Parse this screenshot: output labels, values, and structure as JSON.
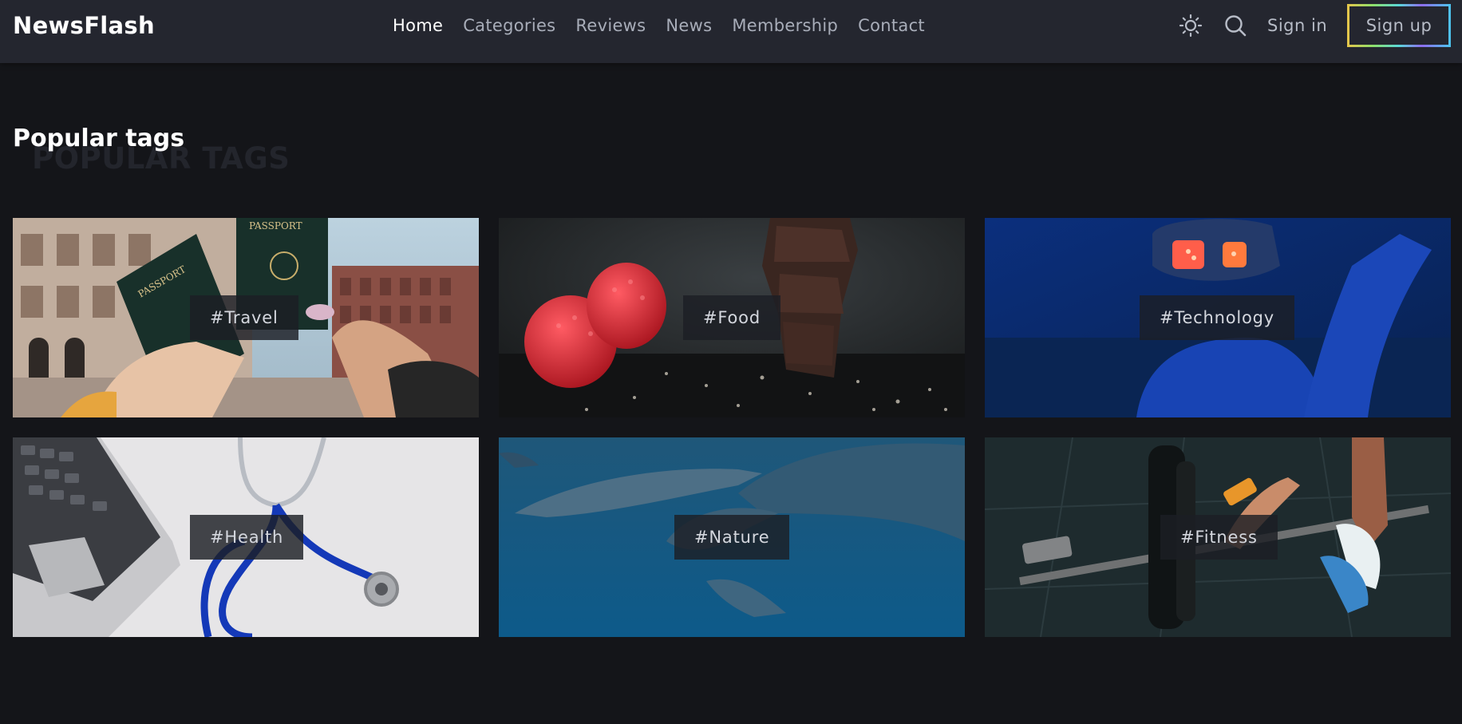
{
  "header": {
    "logo": "NewsFlash",
    "nav": [
      {
        "label": "Home",
        "active": true
      },
      {
        "label": "Categories",
        "active": false
      },
      {
        "label": "Reviews",
        "active": false
      },
      {
        "label": "News",
        "active": false
      },
      {
        "label": "Membership",
        "active": false
      },
      {
        "label": "Contact",
        "active": false
      }
    ],
    "icons": [
      "sun-icon",
      "search-icon"
    ],
    "sign_in": "Sign in",
    "sign_up": "Sign up"
  },
  "section": {
    "title": "Popular tags",
    "background_text": "POPULAR TAGS"
  },
  "tags": [
    {
      "label": "#Travel",
      "image": "hands-holding-passports"
    },
    {
      "label": "#Food",
      "image": "raspberries-and-chocolate"
    },
    {
      "label": "#Technology",
      "image": "person-wearing-vr-headset"
    },
    {
      "label": "#Health",
      "image": "stethoscope-and-laptop"
    },
    {
      "label": "#Nature",
      "image": "dolphins-underwater"
    },
    {
      "label": "#Fitness",
      "image": "barbell-gym-floor"
    }
  ],
  "colors": {
    "background": "#141519",
    "header": "#24262f",
    "nav_text": "#a8adb9",
    "nav_active": "#ffffff"
  }
}
